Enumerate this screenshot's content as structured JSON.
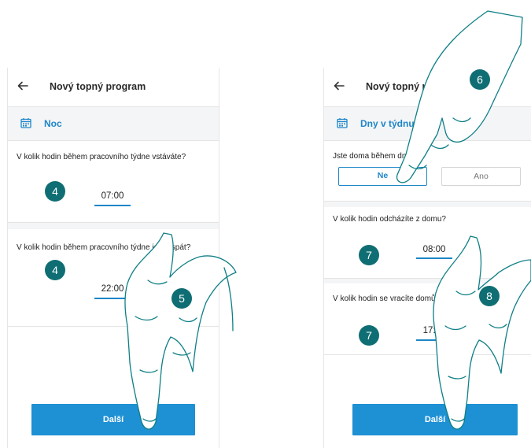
{
  "left_screen": {
    "header_title": "Nový topný program",
    "program_type": "Noc",
    "wake_question": "V kolik hodin během pracovního týdne vstáváte?",
    "wake_time": "07:00",
    "sleep_question": "V kolik hodin během pracovního týdne jdete spát?",
    "sleep_time": "22:00",
    "next_button": "Další"
  },
  "right_screen": {
    "header_title": "Nový topný program",
    "program_type": "Dny v týdnu",
    "home_question": "Jste doma během dne?",
    "option_no": "Ne",
    "option_yes": "Ano",
    "leave_question": "V kolik hodin odcházíte z domu?",
    "leave_time": "08:00",
    "return_question": "V kolik hodin se vracíte domů?",
    "return_time": "17:00",
    "next_button": "Další"
  },
  "step_badges": {
    "wake": "4",
    "sleep": "4",
    "next_left": "5",
    "home_toggle": "6",
    "leave": "7",
    "return": "7",
    "next_right": "8"
  },
  "colors": {
    "accent": "#1d86c8",
    "button": "#1e90d4",
    "badge": "#0f6e73",
    "hand_outline": "#0f7f86"
  }
}
